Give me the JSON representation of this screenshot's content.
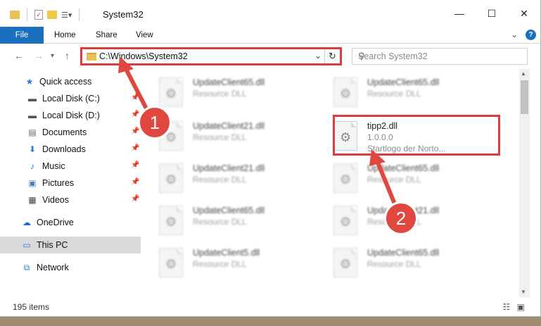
{
  "window": {
    "title": "System32"
  },
  "ribbon": {
    "file": "File",
    "home": "Home",
    "share": "Share",
    "view": "View",
    "help": "?"
  },
  "nav": {
    "address": "C:\\Windows\\System32",
    "search_placeholder": "Search System32"
  },
  "sidebar": {
    "items": [
      {
        "label": "Quick access",
        "icon": "star-icon"
      },
      {
        "label": "Local Disk (C:)",
        "icon": "drive-icon",
        "pinned": true
      },
      {
        "label": "Local Disk (D:)",
        "icon": "drive-icon",
        "pinned": true
      },
      {
        "label": "Documents",
        "icon": "documents-icon",
        "pinned": true
      },
      {
        "label": "Downloads",
        "icon": "download-icon",
        "pinned": true
      },
      {
        "label": "Music",
        "icon": "music-icon",
        "pinned": true
      },
      {
        "label": "Pictures",
        "icon": "pictures-icon",
        "pinned": true
      },
      {
        "label": "Videos",
        "icon": "videos-icon",
        "pinned": true
      },
      {
        "label": "OneDrive",
        "icon": "cloud-icon"
      },
      {
        "label": "This PC",
        "icon": "pc-icon",
        "selected": true
      },
      {
        "label": "Network",
        "icon": "network-icon"
      }
    ]
  },
  "files": [
    {
      "name": "UpdateClient65.dll",
      "type": "Resource DLL"
    },
    {
      "name": "UpdateClient65.dll",
      "type": "Resource DLL"
    },
    {
      "name": "UpdateClient21.dll",
      "type": "Resource DLL"
    },
    {
      "name": "tipp2.dll",
      "version": "1.0.0.0",
      "desc": "Startlogo der Norto..."
    },
    {
      "name": "UpdateClient21.dll",
      "type": "Resource DLL"
    },
    {
      "name": "UpdateClient65.dll",
      "type": "Resource DLL"
    },
    {
      "name": "UpdateClient65.dll",
      "type": "Resource DLL"
    },
    {
      "name": "UpdateClient21.dll",
      "type": "Resource DLL"
    },
    {
      "name": "UpdateClient5.dll",
      "type": "Resource DLL"
    },
    {
      "name": "UpdateClient65.dll",
      "type": "Resource DLL"
    }
  ],
  "status": {
    "count": "195 items"
  },
  "annotations": {
    "step1": "1",
    "step2": "2",
    "color": "#e0473f"
  }
}
